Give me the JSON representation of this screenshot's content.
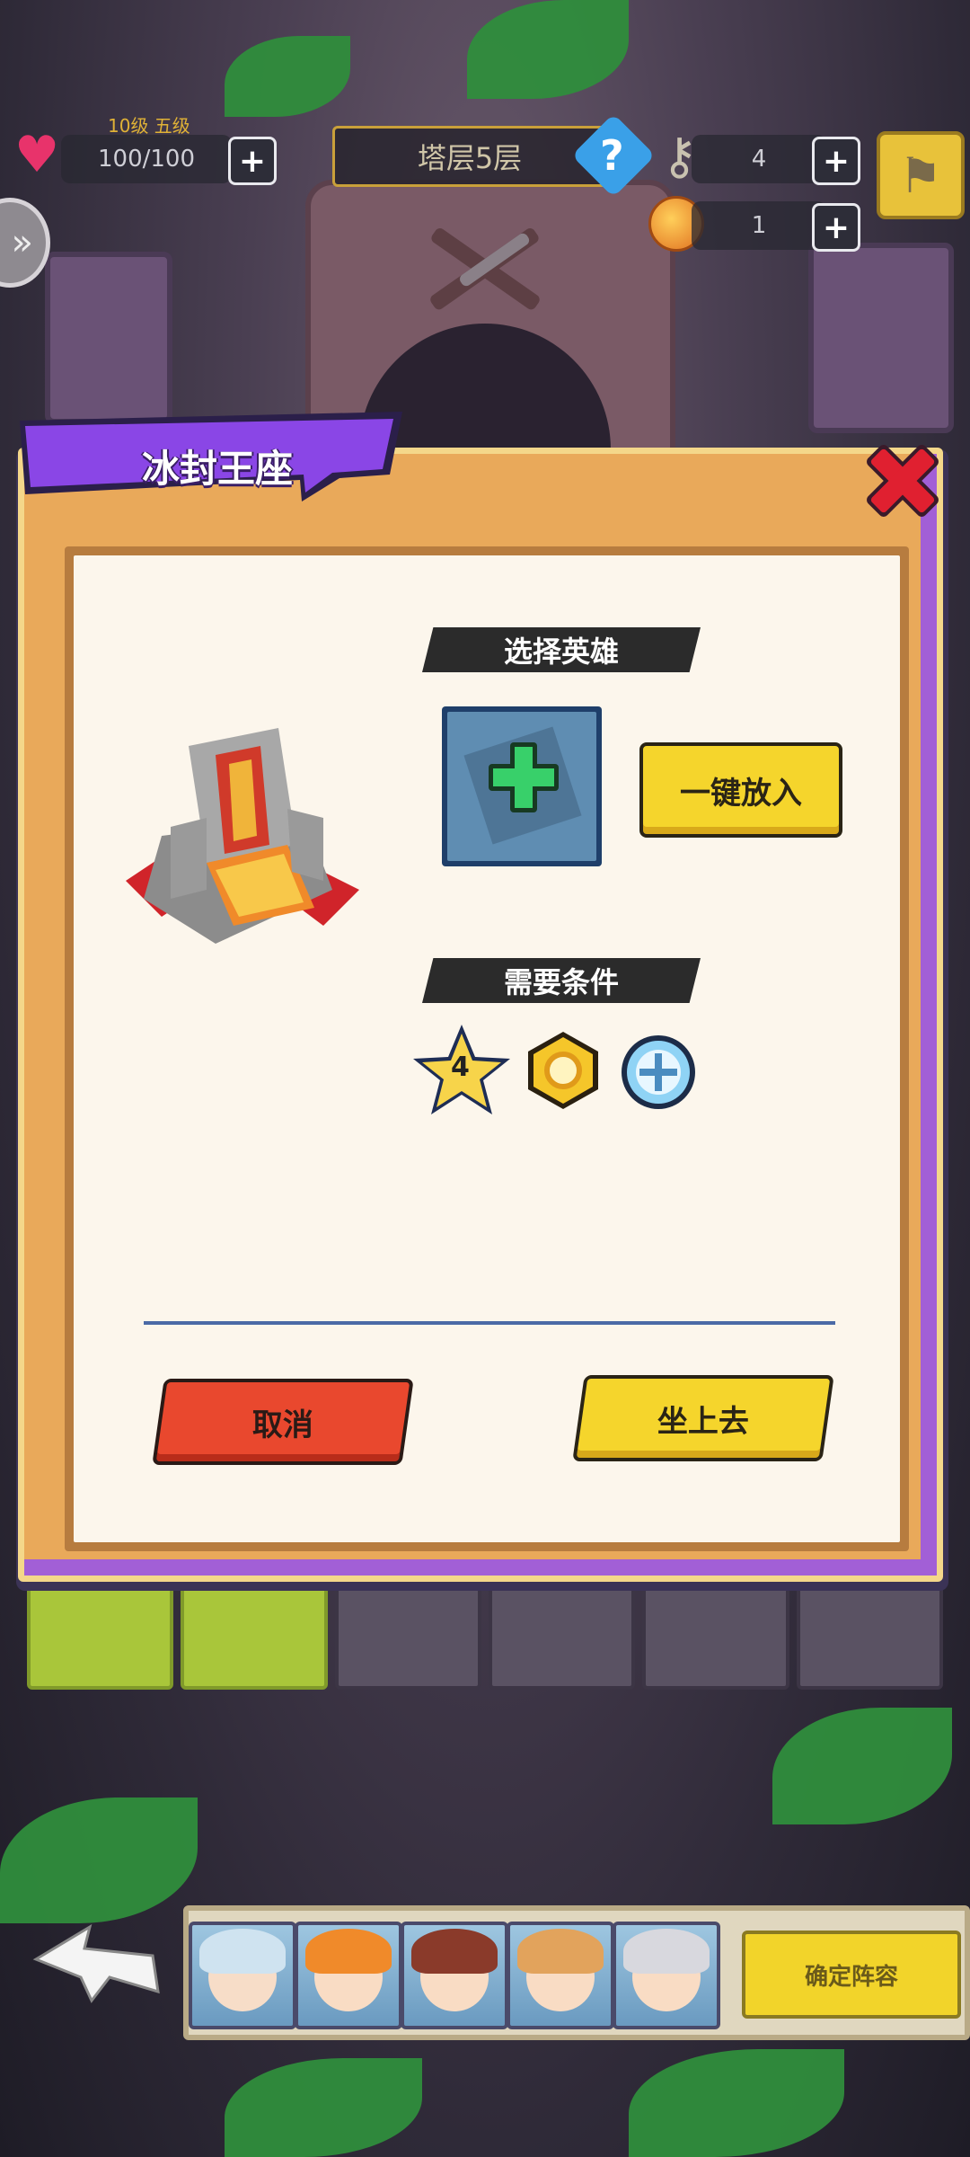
{
  "hud": {
    "level_label": "10级 五级",
    "hp_value": "100/100",
    "floor_label": "塔层5层",
    "key_count": "4",
    "coin_count": "1",
    "help_symbol": "?"
  },
  "modal": {
    "title": "冰封王座",
    "select_hero_header": "选择英雄",
    "quick_place_button": "一键放入",
    "requirements_header": "需要条件",
    "requirements": {
      "star_level": "4"
    },
    "cancel_button": "取消",
    "confirm_button": "坐上去"
  },
  "bottom": {
    "confirm_button": "确定阵容",
    "heroes": [
      {
        "name": "hero-1",
        "hair_color": "#cfe3f0",
        "face_color": "#f7ddc8"
      },
      {
        "name": "hero-2",
        "hair_color": "#f08a2a",
        "face_color": "#f9dcc4"
      },
      {
        "name": "hero-3",
        "hair_color": "#8a3a2a",
        "face_color": "#f9dcc4"
      },
      {
        "name": "hero-4",
        "hair_color": "#e2a35c",
        "face_color": "#f9dcc4"
      },
      {
        "name": "hero-5",
        "hair_color": "#d8d8de",
        "face_color": "#f9dcc4"
      }
    ]
  },
  "colors": {
    "modal_body": "#e9a95a",
    "banner_purple": "#7a3ad0",
    "button_yellow": "#f5d52c",
    "button_red": "#e9482e",
    "close_red": "#e02030"
  }
}
